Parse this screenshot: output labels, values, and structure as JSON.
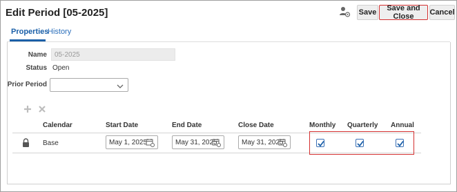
{
  "header": {
    "title": "Edit Period [05-2025]",
    "icon": "user-settings-icon",
    "buttons": {
      "save": "Save",
      "save_and_close": "Save and Close",
      "cancel": "Cancel"
    }
  },
  "tabs": [
    {
      "label": "Properties",
      "active": true
    },
    {
      "label": "History",
      "active": false
    }
  ],
  "form": {
    "name_label": "Name",
    "name_value": "05-2025",
    "status_label": "Status",
    "status_value": "Open",
    "prior_period_label": "Prior Period",
    "prior_period_value": ""
  },
  "toolbar": {
    "add_icon": "plus-icon",
    "remove_icon": "x-icon"
  },
  "grid": {
    "columns": [
      "Calendar",
      "Start Date",
      "End Date",
      "Close Date",
      "Monthly",
      "Quarterly",
      "Annual"
    ],
    "rows": [
      {
        "calendar": "Base",
        "start_date": "May 1, 2025",
        "end_date": "May 31, 2025",
        "close_date": "May 31, 2025",
        "monthly": true,
        "quarterly": true,
        "annual": true
      }
    ]
  },
  "colors": {
    "accent": "#1a5fa8",
    "highlight": "#d32f2f",
    "checkbox": "#3a6fb5"
  }
}
